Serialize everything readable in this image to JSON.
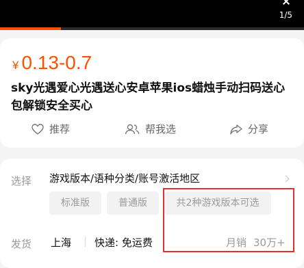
{
  "header": {
    "page_indicator": "1/5",
    "progress_fraction": 0.2
  },
  "product": {
    "currency": "¥",
    "price_range": "0.13-0.7",
    "title": "sky光遇爱心光遇送心安卓苹果ios蜡烛手动扫码送心包解锁安全买心"
  },
  "actions": {
    "recommend_label": "推荐",
    "help_choose_label": "帮我选",
    "share_label": "分享"
  },
  "options": {
    "select_label": "选择",
    "variants_text": "游戏版本/语种分类/账号激活地区",
    "chips": [
      "标准版",
      "普通版",
      "共2种游戏版本可选"
    ]
  },
  "shipping": {
    "label": "发货",
    "origin": "上海",
    "delivery": "快递: 免运费",
    "sales_label": "月销",
    "sales_value": "30万+"
  },
  "colors": {
    "accent": "#ff5000",
    "highlight_box": "#e03030"
  }
}
